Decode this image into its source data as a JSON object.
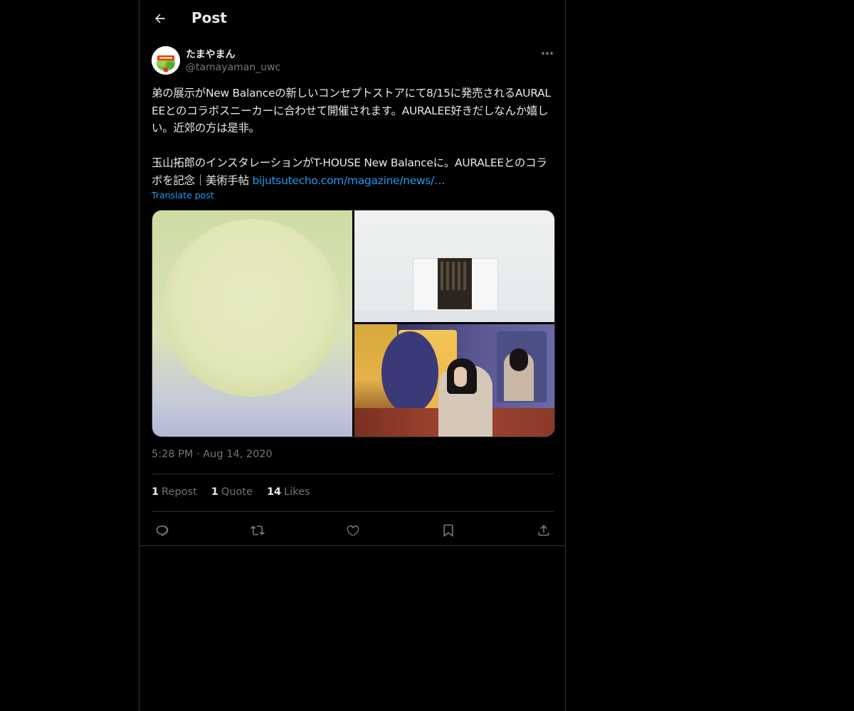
{
  "header": {
    "title": "Post",
    "back_icon": "arrow-left-icon"
  },
  "author": {
    "display_name": "たまやまん",
    "handle": "@tamayaman_uwc",
    "avatar": "avatar-image",
    "more_icon": "more-horizontal-icon"
  },
  "post": {
    "text": "弟の展示がNew Balanceの新しいコンセプトストアにて8/15に発売されるAURALEEとのコラボスニーカーに合わせて開催されます。AURALEE好きだしなんか嬉しい。近郊の方は是非。\n\n玉山拓郎のインスタレーションがT-HOUSE New Balanceに。AURALEEとのコラボを記念｜美術手帖 ",
    "link_text": "bijutsutecho.com/magazine/news/…",
    "translate_label": "Translate post"
  },
  "media": {
    "images": [
      "glowing-disc-image",
      "white-room-door-image",
      "colorful-mirror-installation-image"
    ]
  },
  "meta": {
    "time": "5:28 PM",
    "separator": "·",
    "date": "Aug 14, 2020"
  },
  "stats": [
    {
      "count": "1",
      "label": "Repost"
    },
    {
      "count": "1",
      "label": "Quote"
    },
    {
      "count": "14",
      "label": "Likes"
    }
  ],
  "actions": [
    {
      "icon": "reply-icon"
    },
    {
      "icon": "repost-icon"
    },
    {
      "icon": "like-icon"
    },
    {
      "icon": "bookmark-icon"
    },
    {
      "icon": "share-icon"
    }
  ],
  "colors": {
    "background": "#000000",
    "text": "#e7e9ea",
    "secondary": "#71767b",
    "accent": "#1d9bf0",
    "border": "#2f3336"
  }
}
